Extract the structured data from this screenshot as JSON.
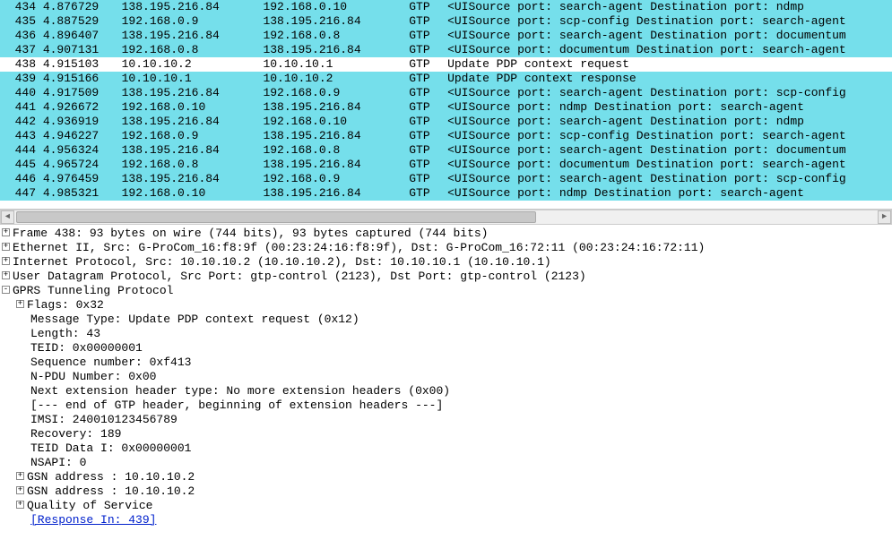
{
  "packet_list": [
    {
      "no": "434",
      "time": "4.876729",
      "src": "138.195.216.84",
      "dst": "192.168.0.10",
      "proto": "GTP",
      "info": "<UISource port: search-agent  Destination port: ndmp",
      "hl": true,
      "sel": false
    },
    {
      "no": "435",
      "time": "4.887529",
      "src": "192.168.0.9",
      "dst": "138.195.216.84",
      "proto": "GTP",
      "info": "<UISource port: scp-config  Destination port: search-agent",
      "hl": true,
      "sel": false
    },
    {
      "no": "436",
      "time": "4.896407",
      "src": "138.195.216.84",
      "dst": "192.168.0.8",
      "proto": "GTP",
      "info": "<UISource port: search-agent  Destination port: documentum",
      "hl": true,
      "sel": false
    },
    {
      "no": "437",
      "time": "4.907131",
      "src": "192.168.0.8",
      "dst": "138.195.216.84",
      "proto": "GTP",
      "info": "<UISource port: documentum  Destination port: search-agent",
      "hl": true,
      "sel": false
    },
    {
      "no": "438",
      "time": "4.915103",
      "src": "10.10.10.2",
      "dst": "10.10.10.1",
      "proto": "GTP",
      "info": "   Update PDP context request",
      "hl": false,
      "sel": true
    },
    {
      "no": "439",
      "time": "4.915166",
      "src": "10.10.10.1",
      "dst": "10.10.10.2",
      "proto": "GTP",
      "info": "   Update PDP context response",
      "hl": true,
      "sel": false
    },
    {
      "no": "440",
      "time": "4.917509",
      "src": "138.195.216.84",
      "dst": "192.168.0.9",
      "proto": "GTP",
      "info": "<UISource port: search-agent  Destination port: scp-config",
      "hl": true,
      "sel": false
    },
    {
      "no": "441",
      "time": "4.926672",
      "src": "192.168.0.10",
      "dst": "138.195.216.84",
      "proto": "GTP",
      "info": "<UISource port: ndmp  Destination port: search-agent",
      "hl": true,
      "sel": false
    },
    {
      "no": "442",
      "time": "4.936919",
      "src": "138.195.216.84",
      "dst": "192.168.0.10",
      "proto": "GTP",
      "info": "<UISource port: search-agent  Destination port: ndmp",
      "hl": true,
      "sel": false
    },
    {
      "no": "443",
      "time": "4.946227",
      "src": "192.168.0.9",
      "dst": "138.195.216.84",
      "proto": "GTP",
      "info": "<UISource port: scp-config  Destination port: search-agent",
      "hl": true,
      "sel": false
    },
    {
      "no": "444",
      "time": "4.956324",
      "src": "138.195.216.84",
      "dst": "192.168.0.8",
      "proto": "GTP",
      "info": "<UISource port: search-agent  Destination port: documentum",
      "hl": true,
      "sel": false
    },
    {
      "no": "445",
      "time": "4.965724",
      "src": "192.168.0.8",
      "dst": "138.195.216.84",
      "proto": "GTP",
      "info": "<UISource port: documentum  Destination port: search-agent",
      "hl": true,
      "sel": false
    },
    {
      "no": "446",
      "time": "4.976459",
      "src": "138.195.216.84",
      "dst": "192.168.0.9",
      "proto": "GTP",
      "info": "<UISource port: search-agent  Destination port: scp-config",
      "hl": true,
      "sel": false
    },
    {
      "no": "447",
      "time": "4.985321",
      "src": "192.168.0.10",
      "dst": "138.195.216.84",
      "proto": "GTP",
      "info": "<UISource port: ndmp  Destination port: search-agent",
      "hl": true,
      "sel": false
    }
  ],
  "details": {
    "frame": "Frame 438: 93 bytes on wire (744 bits), 93 bytes captured (744 bits)",
    "eth": "Ethernet II, Src: G-ProCom_16:f8:9f (00:23:24:16:f8:9f), Dst: G-ProCom_16:72:11 (00:23:24:16:72:11)",
    "ip": "Internet Protocol, Src: 10.10.10.2 (10.10.10.2), Dst: 10.10.10.1 (10.10.10.1)",
    "udp": "User Datagram Protocol, Src Port: gtp-control (2123), Dst Port: gtp-control (2123)",
    "gtp": "GPRS Tunneling Protocol",
    "flags": "Flags: 0x32",
    "msgtype": "Message Type: Update PDP context request (0x12)",
    "length": "Length: 43",
    "teid": "TEID: 0x00000001",
    "seq": "Sequence number: 0xf413",
    "npdu": "N-PDU Number: 0x00",
    "nextext": "Next extension header type: No more extension headers (0x00)",
    "endhdr": "[--- end of GTP header, beginning of extension headers ---]",
    "imsi": "IMSI: 240010123456789",
    "recovery": "Recovery: 189",
    "teiddata": "TEID Data I: 0x00000001",
    "nsapi": "NSAPI: 0",
    "gsn1": "GSN address : 10.10.10.2",
    "gsn2": "GSN address : 10.10.10.2",
    "qos": "Quality of Service",
    "respin": "[Response In: 439]"
  }
}
